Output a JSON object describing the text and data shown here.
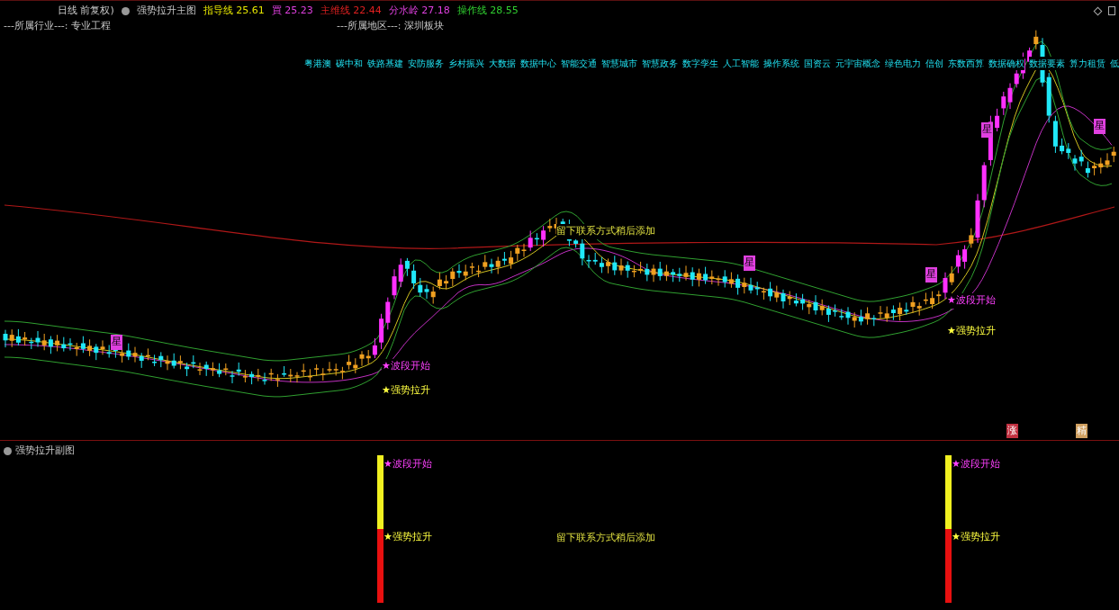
{
  "header": {
    "period": "日线 前复权)",
    "indicator_title": "强势拉升主图",
    "indicators": [
      {
        "name": "指导线",
        "value": "25.61",
        "color": "#e6e600"
      },
      {
        "name": "買",
        "value": "25.23",
        "color": "#e040e0"
      },
      {
        "name": "主维线",
        "value": "22.44",
        "color": "#e02020"
      },
      {
        "name": "分水岭",
        "value": "27.18",
        "color": "#e040e0"
      },
      {
        "name": "操作线",
        "value": "28.55",
        "color": "#30d030"
      }
    ],
    "industry": "---所属行业---: 专业工程",
    "region": "---所属地区---: 深圳板块"
  },
  "concepts": [
    "粤港澳",
    "碳中和",
    "铁路基建",
    "安防服务",
    "乡村振兴",
    "大数据",
    "数据中心",
    "智能交通",
    "智慧城市",
    "智慧政务",
    "数字孪生",
    "人工智能",
    "操作系统",
    "国资云",
    "元宇宙概念",
    "绿色电力",
    "信创",
    "东数西算",
    "数据确权",
    "数据要素",
    "算力租赁",
    "低"
  ],
  "main_chart": {
    "annotations": [
      {
        "text": "留下联系方式稍后添加",
        "kind": "note"
      },
      {
        "text": "★波段开始",
        "kind": "start"
      },
      {
        "text": "★强势拉升",
        "kind": "rise"
      },
      {
        "text": "★波段开始",
        "kind": "start"
      },
      {
        "text": "★强势拉升",
        "kind": "rise"
      },
      {
        "text": "星",
        "kind": "mark"
      },
      {
        "text": "星",
        "kind": "mark"
      },
      {
        "text": "星",
        "kind": "mark"
      },
      {
        "text": "星",
        "kind": "mark"
      },
      {
        "text": "星",
        "kind": "mark"
      }
    ],
    "footer_marks": [
      {
        "text": "涨",
        "color": "#c03040"
      },
      {
        "text": "精",
        "color": "#d0a060"
      }
    ]
  },
  "sub_chart": {
    "title": "强势拉升副图",
    "note": "留下联系方式稍后添加",
    "signals": [
      {
        "start": "★波段开始",
        "rise": "★强势拉升"
      },
      {
        "start": "★波段开始",
        "rise": "★强势拉升"
      }
    ]
  }
}
